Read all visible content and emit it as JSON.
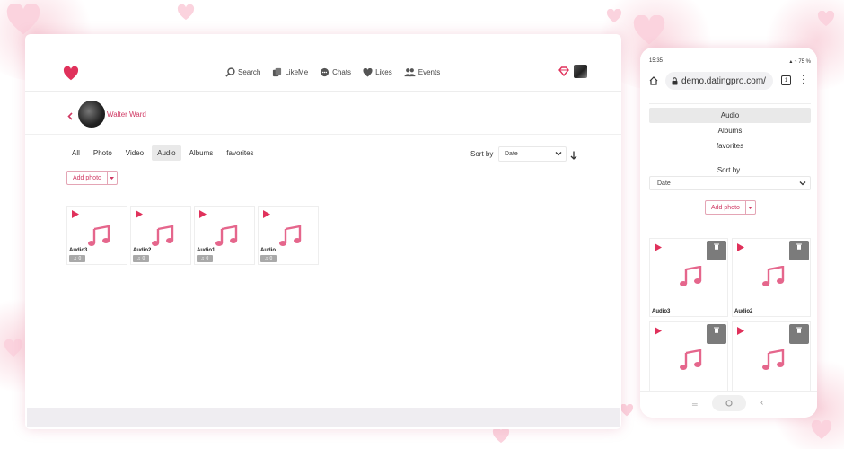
{
  "desktop": {
    "nav": [
      {
        "label": "Search",
        "icon": "search-icon"
      },
      {
        "label": "LikeMe",
        "icon": "likeme-icon"
      },
      {
        "label": "Chats",
        "icon": "chat-icon"
      },
      {
        "label": "Likes",
        "icon": "heart-icon"
      },
      {
        "label": "Events",
        "icon": "people-icon"
      }
    ],
    "user_name": "Walter Ward",
    "tabs": [
      {
        "label": "All",
        "active": false
      },
      {
        "label": "Photo",
        "active": false
      },
      {
        "label": "Video",
        "active": false
      },
      {
        "label": "Audio",
        "active": true
      },
      {
        "label": "Albums",
        "active": false
      },
      {
        "label": "favorites",
        "active": false
      }
    ],
    "sort_label": "Sort by",
    "sort_value": "Date",
    "add_photo_label": "Add photo",
    "audio_items": [
      {
        "title": "Audio3",
        "count": "0"
      },
      {
        "title": "Audio2",
        "count": "0"
      },
      {
        "title": "Audio1",
        "count": "0"
      },
      {
        "title": "Audio",
        "count": "0"
      }
    ]
  },
  "mobile": {
    "time": "15:35",
    "battery": "75 %",
    "url": "demo.datingpro.com/",
    "tab_count": "1",
    "menu": [
      {
        "label": "Audio",
        "active": true
      },
      {
        "label": "Albums",
        "active": false
      },
      {
        "label": "favorites",
        "active": false
      }
    ],
    "sort_label": "Sort by",
    "sort_value": "Date",
    "add_photo_label": "Add photo",
    "audio_items": [
      {
        "title": "Audio3"
      },
      {
        "title": "Audio2"
      },
      {
        "title": ""
      },
      {
        "title": ""
      }
    ]
  },
  "colors": {
    "accent": "#d03a64",
    "note_pink": "#e5668c",
    "heart_bg": "#fbd3de"
  }
}
